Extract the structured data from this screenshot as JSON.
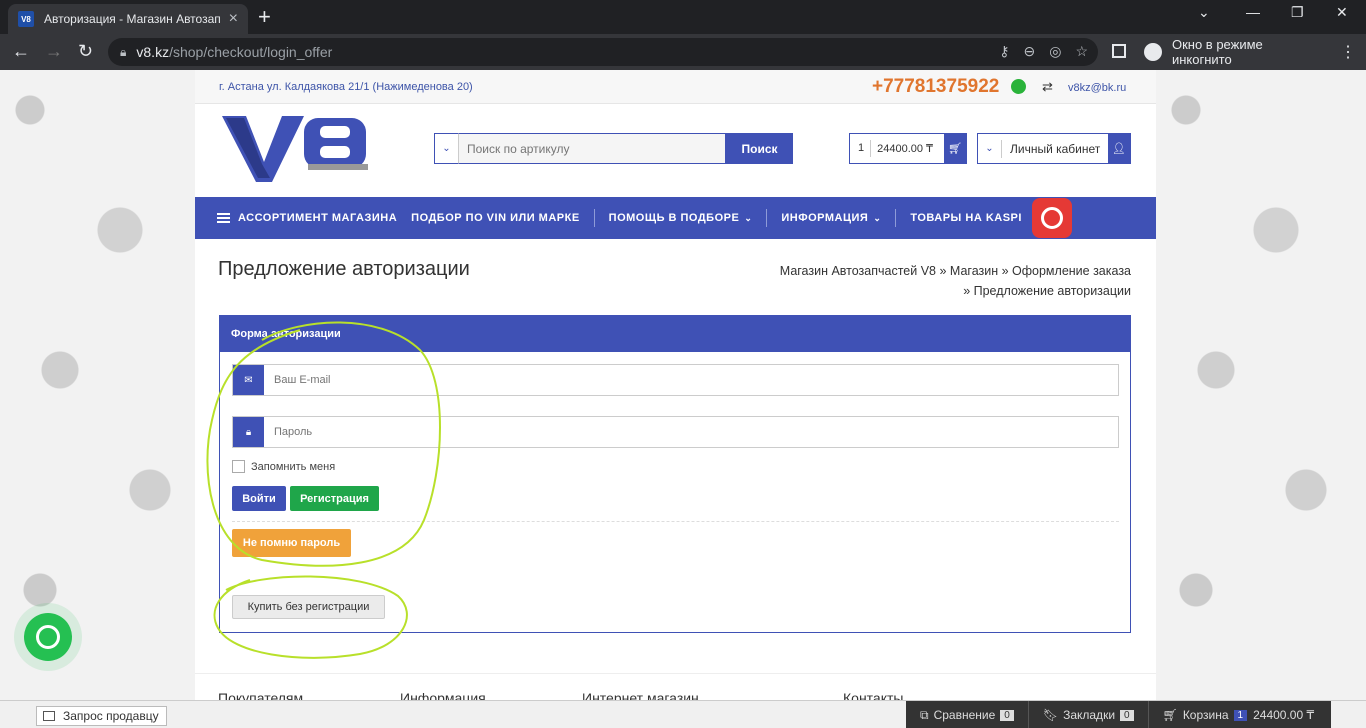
{
  "browser": {
    "tab_title": "Авторизация - Магазин Автозап",
    "favicon_text": "V8",
    "url_host": "v8.kz",
    "url_path": "/shop/checkout/login_offer",
    "incognito_label": "Окно в режиме инкогнито"
  },
  "topline": {
    "address": "г. Астана ул. Калдаякова 21/1 (Нажимеденова 20)",
    "phone": "+77781375922",
    "email": "v8kz@bk.ru"
  },
  "header": {
    "search_placeholder": "Поиск по артикулу",
    "search_button": "Поиск",
    "cart_count": "1",
    "cart_sum": "24400.00 ₸",
    "account_label": "Личный кабинет"
  },
  "nav": {
    "items": [
      "АССОРТИМЕНТ МАГАЗИНА",
      "ПОДБОР ПО VIN ИЛИ МАРКЕ",
      "ПОМОЩЬ В ПОДБОРЕ",
      "ИНФОРМАЦИЯ",
      "ТОВАРЫ НА KASPI"
    ]
  },
  "page": {
    "title": "Предложение авторизации",
    "breadcrumb_line1": "Магазин Автозапчастей V8 » Магазин » Оформление заказа",
    "breadcrumb_line2": "» Предложение авторизации"
  },
  "form": {
    "heading": "Форма авторизации",
    "email_placeholder": "Ваш E-mail",
    "password_placeholder": "Пароль",
    "remember_label": "Запомнить меня",
    "login_button": "Войти",
    "register_button": "Регистрация",
    "forgot_button": "Не помню пароль",
    "guest_button": "Купить без регистрации"
  },
  "footer": {
    "cols": [
      "Покупателям",
      "Информация",
      "Интернет магазин",
      "Контакты"
    ]
  },
  "bottombar": {
    "seller_request": "Запрос продавцу",
    "compare_label": "Сравнение",
    "compare_count": "0",
    "bookmarks_label": "Закладки",
    "bookmarks_count": "0",
    "cart_label": "Корзина",
    "cart_count": "1",
    "cart_sum": "24400.00 ₸"
  },
  "colors": {
    "brand_blue": "#3f51b5",
    "phone_orange": "#e0752e",
    "register_green": "#1fa64a",
    "forgot_orange": "#f0a23a",
    "annotation": "#b8e02a"
  }
}
